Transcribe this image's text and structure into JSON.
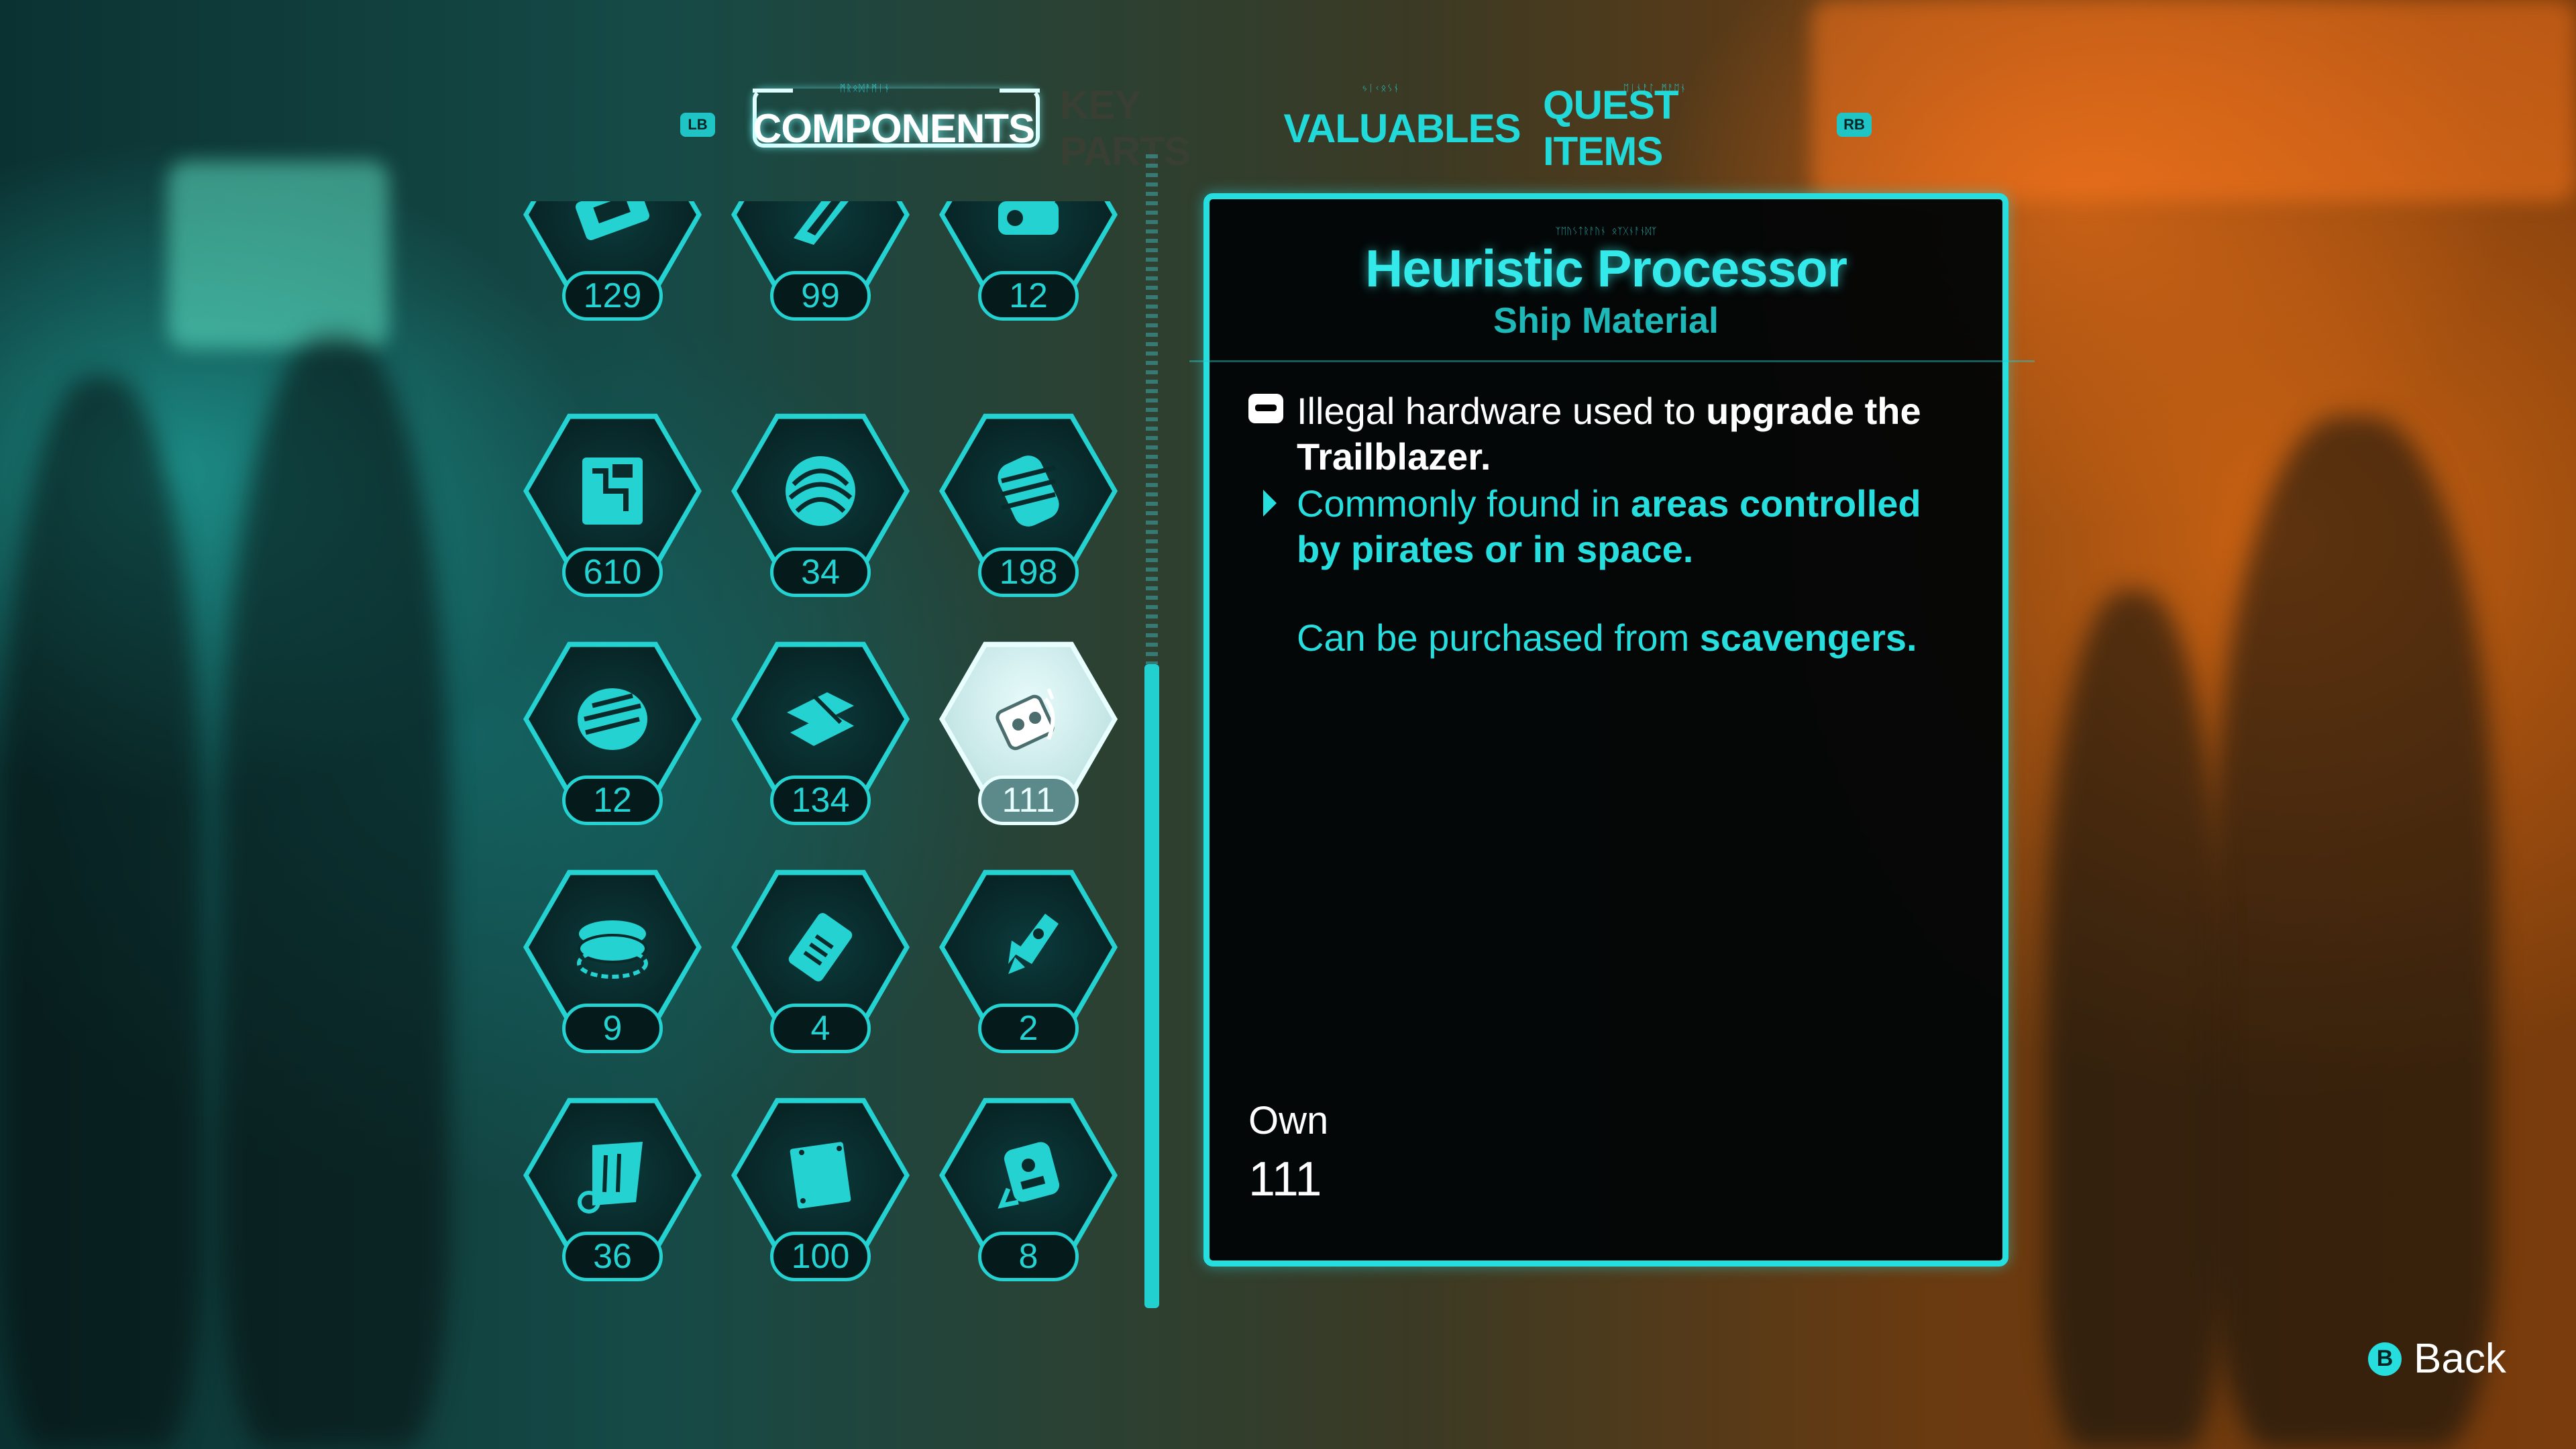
{
  "tabs": {
    "left_bumper": "LB",
    "right_bumper": "RB",
    "items": [
      {
        "label": "COMPONENTS",
        "state": "active"
      },
      {
        "label": "KEY PARTS",
        "state": "inactive"
      },
      {
        "label": "VALUABLES",
        "state": "normal"
      },
      {
        "label": "QUEST ITEMS",
        "state": "normal"
      }
    ]
  },
  "inventory": {
    "items": [
      {
        "icon": "circuit-chip-icon",
        "count": "129"
      },
      {
        "icon": "blade-shard-icon",
        "count": "99"
      },
      {
        "icon": "canister-icon",
        "count": "12"
      },
      {
        "icon": "circuit-board-icon",
        "count": "610"
      },
      {
        "icon": "yarn-ball-icon",
        "count": "34"
      },
      {
        "icon": "barrel-coil-icon",
        "count": "198"
      },
      {
        "icon": "wound-ball-icon",
        "count": "12"
      },
      {
        "icon": "crystal-plates-icon",
        "count": "134"
      },
      {
        "icon": "heuristic-processor-icon",
        "count": "111",
        "selected": true
      },
      {
        "icon": "disc-stack-icon",
        "count": "9"
      },
      {
        "icon": "microchip-icon",
        "count": "4"
      },
      {
        "icon": "rocket-icon",
        "count": "2"
      },
      {
        "icon": "scroll-sheet-icon",
        "count": "36"
      },
      {
        "icon": "metal-plate-icon",
        "count": "100"
      },
      {
        "icon": "robot-module-icon",
        "count": "8"
      }
    ]
  },
  "details": {
    "title": "Heuristic Processor",
    "type": "Ship Material",
    "description_prefix": "Illegal hardware used to ",
    "description_bold": "upgrade the Trailblazer.",
    "found_prefix": "Commonly found in ",
    "found_bold": "areas controlled by pirates or in space.",
    "purchase_prefix": "Can be purchased from ",
    "purchase_bold": "scavengers.",
    "own_label": "Own",
    "own_value": "111"
  },
  "footer": {
    "back_button_glyph": "B",
    "back_label": "Back"
  },
  "colors": {
    "accent": "#27dede",
    "selected": "#e9ffff"
  }
}
